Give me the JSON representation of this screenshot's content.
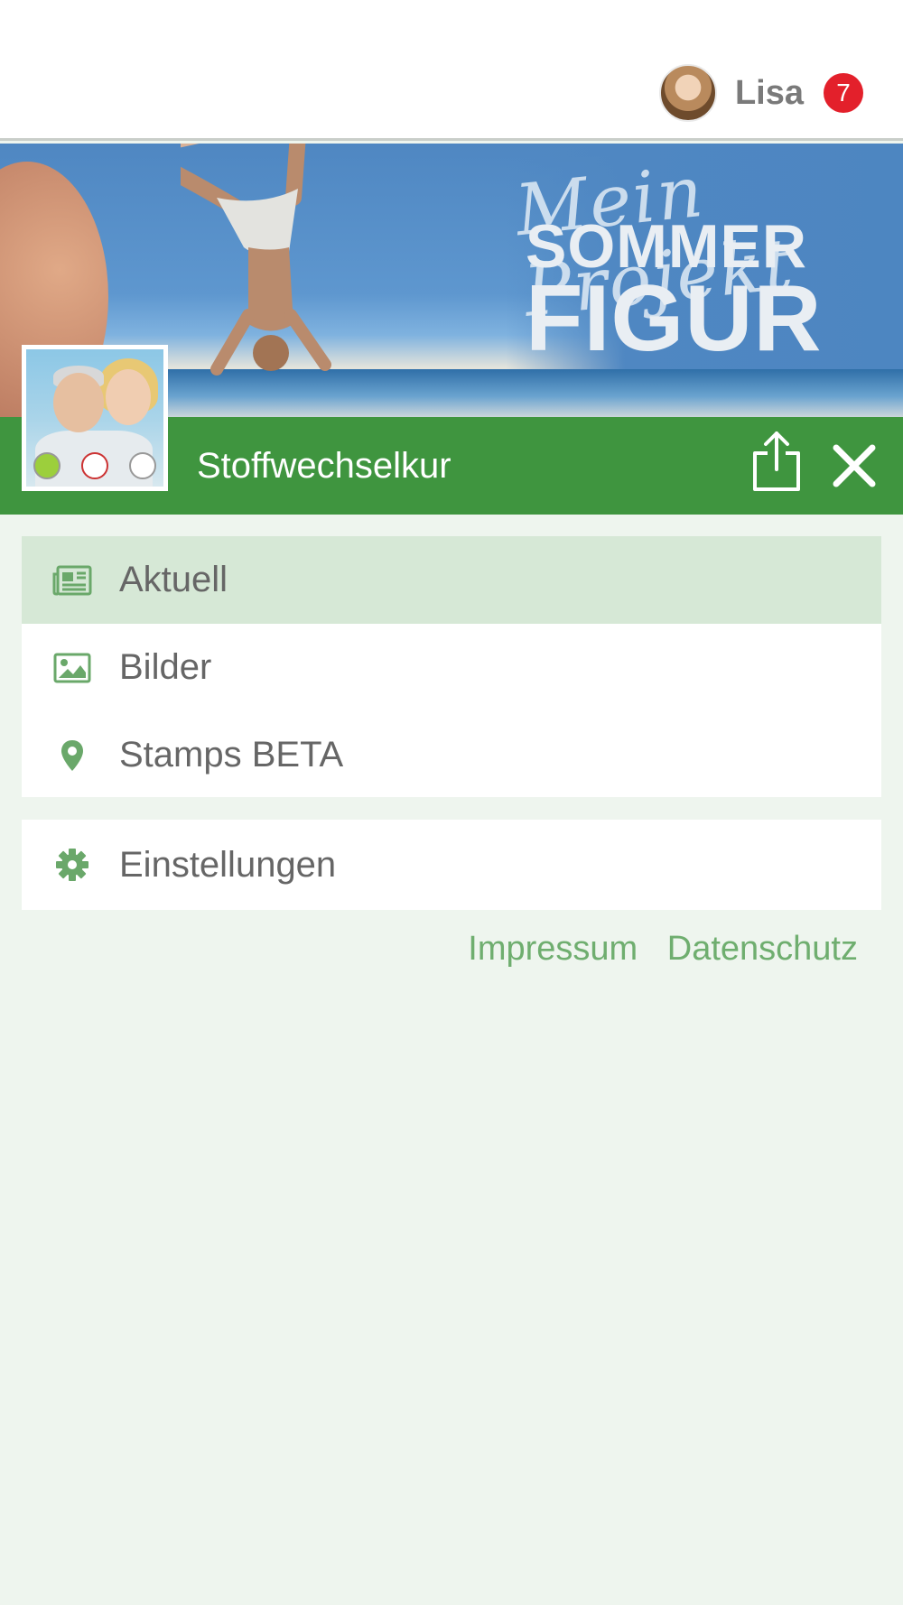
{
  "user": {
    "name": "Lisa",
    "notification_count": "7"
  },
  "banner": {
    "script_line": "Mein Projekt",
    "line1": "SOMMER",
    "line2": "FIGUR"
  },
  "group": {
    "title": "Stoffwechselkur"
  },
  "menu": {
    "items": [
      {
        "label": "Aktuell",
        "icon": "newspaper-icon",
        "active": true
      },
      {
        "label": "Bilder",
        "icon": "image-icon",
        "active": false
      },
      {
        "label": "Stamps BETA",
        "icon": "map-pin-icon",
        "active": false
      }
    ],
    "settings": {
      "label": "Einstellungen",
      "icon": "gear-icon"
    }
  },
  "footer": {
    "impressum": "Impressum",
    "datenschutz": "Datenschutz"
  },
  "colors": {
    "brand_green": "#3f953f",
    "active_row": "#d6e8d6",
    "badge_red": "#e3202b",
    "page_bg": "#eef5ee",
    "link_green": "#6fae6f"
  }
}
